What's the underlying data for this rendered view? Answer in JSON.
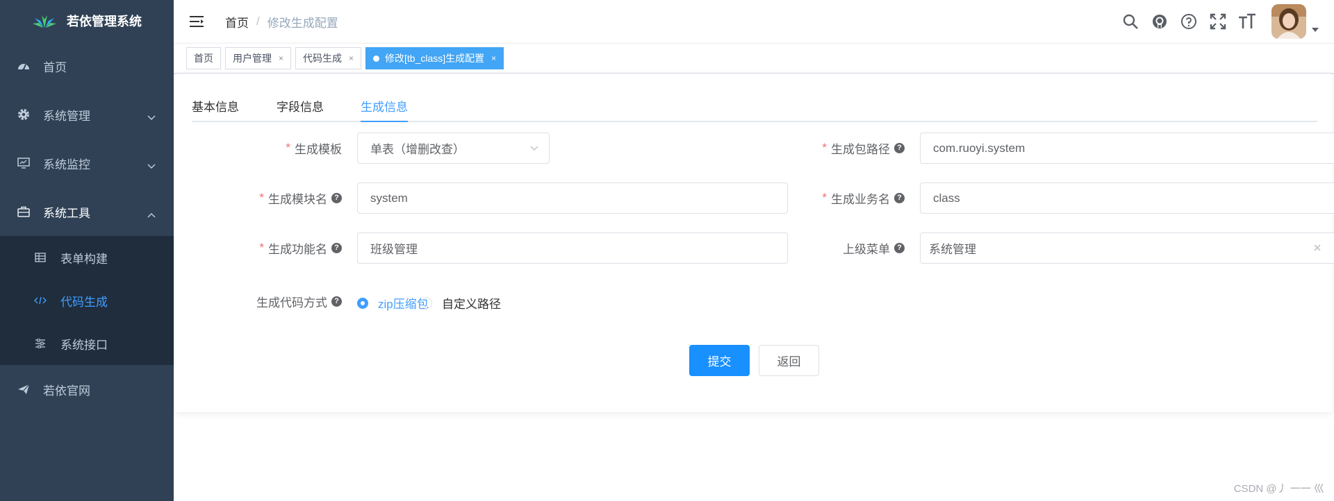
{
  "app": {
    "title": "若依管理系统"
  },
  "sidebar": {
    "items": [
      {
        "label": "首页",
        "icon": "dashboard-icon"
      },
      {
        "label": "系统管理",
        "icon": "system-gear-icon"
      },
      {
        "label": "系统监控",
        "icon": "monitor-icon"
      },
      {
        "label": "系统工具",
        "icon": "toolbox-icon"
      },
      {
        "label": "若依官网",
        "icon": "paper-plane-icon"
      }
    ],
    "subitems": [
      {
        "label": "表单构建",
        "icon": "table-icon"
      },
      {
        "label": "代码生成",
        "icon": "code-icon"
      },
      {
        "label": "系统接口",
        "icon": "sliders-icon"
      }
    ]
  },
  "breadcrumb": {
    "home": "首页",
    "separator": "/",
    "current": "修改生成配置"
  },
  "tags": [
    {
      "label": "首页"
    },
    {
      "label": "用户管理",
      "close": "×"
    },
    {
      "label": "代码生成",
      "close": "×"
    },
    {
      "label": "修改[tb_class]生成配置",
      "close": "×"
    }
  ],
  "tabs": [
    {
      "label": "基本信息"
    },
    {
      "label": "字段信息"
    },
    {
      "label": "生成信息"
    }
  ],
  "form": {
    "required_mark": "*",
    "help": "?",
    "template": {
      "label": "生成模板",
      "value": "单表（增删改查）"
    },
    "package": {
      "label": "生成包路径",
      "value": "com.ruoyi.system"
    },
    "module": {
      "label": "生成模块名",
      "value": "system"
    },
    "business": {
      "label": "生成业务名",
      "value": "class"
    },
    "function": {
      "label": "生成功能名",
      "value": "班级管理"
    },
    "parent_menu": {
      "label": "上级菜单",
      "value": "系统管理"
    },
    "gen_type": {
      "label": "生成代码方式",
      "options": [
        {
          "label": "zip压缩包",
          "checked": true
        },
        {
          "label": "自定义路径",
          "checked": false
        }
      ]
    },
    "submit_label": "提交",
    "back_label": "返回"
  },
  "watermark": "CSDN @丿 一一 巛",
  "colors": {
    "sidebar_bg": "#304156",
    "submenu_bg": "#1f2d3d",
    "primary": "#1890ff",
    "active_tag": "#42a5f5",
    "link": "#409eff",
    "required": "#f56c6c"
  }
}
